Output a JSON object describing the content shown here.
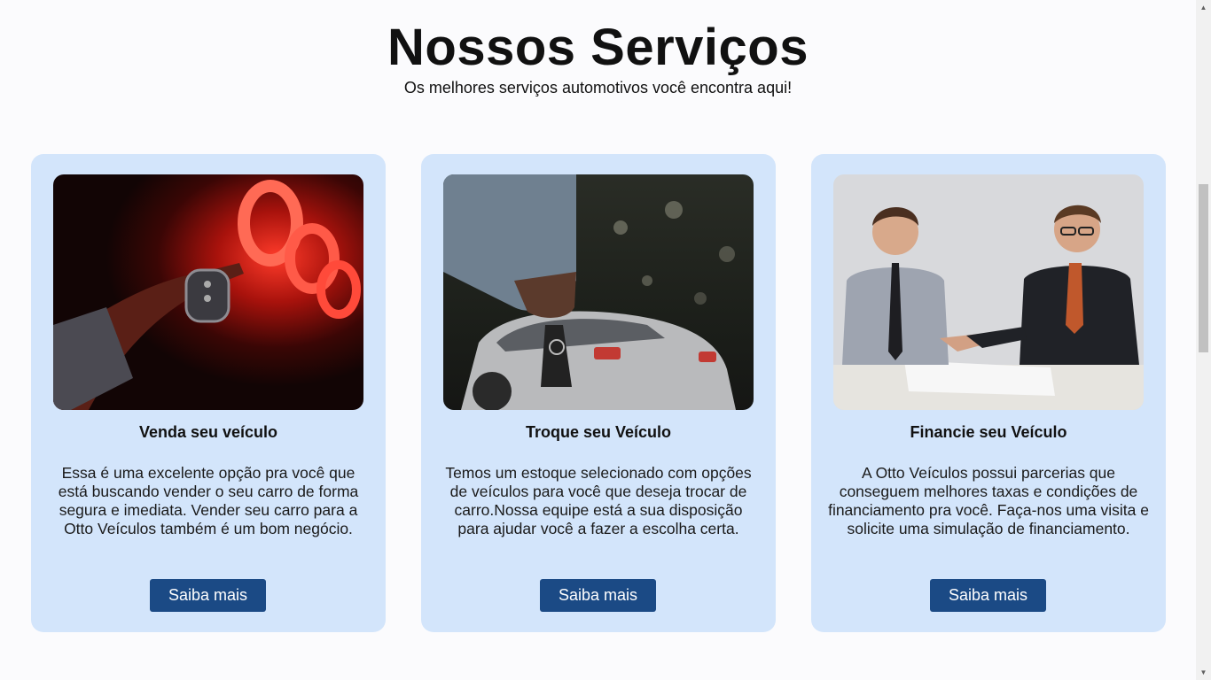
{
  "header": {
    "title": "Nossos Serviços",
    "subtitle": "Os melhores serviços automotivos você encontra aqui!"
  },
  "cards": [
    {
      "title": "Venda seu veículo",
      "text": "Essa é uma excelente opção pra você que está buscando vender o seu carro de forma segura e imediata. Vender seu carro para a Otto Veículos também é um bom negócio.",
      "button": "Saiba mais"
    },
    {
      "title": "Troque seu Veículo",
      "text": "Temos um estoque selecionado com opções de veículos para você que deseja trocar de carro.Nossa equipe está a sua disposição para ajudar você a fazer a escolha certa.",
      "button": "Saiba mais"
    },
    {
      "title": "Financie seu Veículo",
      "text": "A Otto Veículos possui parcerias que conseguem melhores taxas e condições de financiamento pra você. Faça-nos uma visita e solicite uma simulação de financiamento.",
      "button": "Saiba mais"
    }
  ],
  "colors": {
    "card_background": "#d3e5fb",
    "button_background": "#1b4a85",
    "page_background": "#fbfbfd"
  },
  "scrollbar": {
    "position_fraction": 0.27
  }
}
